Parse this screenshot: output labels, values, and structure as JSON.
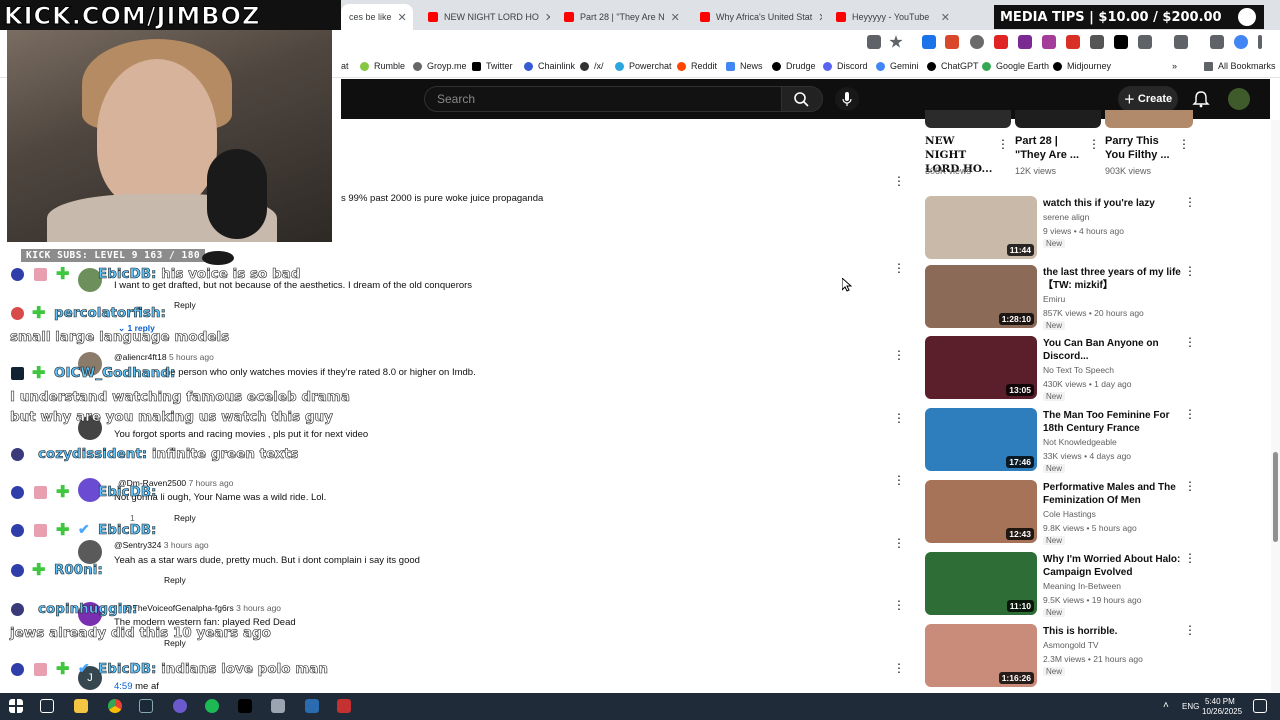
{
  "stream": {
    "brand": "KICK.COM/JIMBOZ",
    "kick_subs": "KICK SUBS: LEVEL 9 163 / 180",
    "media_tips": "MEDIA TIPS | $10.00 / $200.00"
  },
  "browser": {
    "tabs": [
      {
        "title": "ces be like",
        "color": "#ffffff",
        "active": true
      },
      {
        "title": "NEW NIGHT LORD HO",
        "color": "#ff0000"
      },
      {
        "title": "Part 28 | \"They Are N",
        "color": "#ff0000"
      },
      {
        "title": "Why Africa's United Stat",
        "color": "#ff0000"
      },
      {
        "title": "Heyyyyy - YouTube",
        "color": "#ff0000"
      }
    ],
    "bookmarks": [
      {
        "label": "at",
        "color": "#888888"
      },
      {
        "label": "Rumble",
        "color": "#85c742"
      },
      {
        "label": "Groyp.me",
        "color": "#666666"
      },
      {
        "label": "Twitter",
        "color": "#000000"
      },
      {
        "label": "Chainlink",
        "color": "#375bd2"
      },
      {
        "label": "/x/",
        "color": "#333333"
      },
      {
        "label": "Powerchat",
        "color": "#2ba6de"
      },
      {
        "label": "Reddit",
        "color": "#ff4500"
      },
      {
        "label": "News",
        "color": "#4285f4"
      },
      {
        "label": "Drudge",
        "color": "#000000"
      },
      {
        "label": "Discord",
        "color": "#5865f2"
      },
      {
        "label": "Gemini",
        "color": "#4285f4"
      },
      {
        "label": "ChatGPT",
        "color": "#000000"
      },
      {
        "label": "Google Earth",
        "color": "#34a853"
      },
      {
        "label": "Midjourney",
        "color": "#000000"
      }
    ],
    "all_bookmarks": "All Bookmarks"
  },
  "youtube": {
    "search_placeholder": "Search",
    "create_label": "Create"
  },
  "comments": [
    {
      "text": "s 99% past 2000 is pure woke juice propaganda"
    },
    {
      "text": "I want to get drafted, but not because of the aesthetics. I dream of the old conquerors",
      "reply": "Reply",
      "replies": "1 reply"
    },
    {
      "author": "@aliencr4ft18",
      "ago": "5 hours ago",
      "text": "he person who only watches movies if they're rated 8.0 or higher on Imdb."
    },
    {
      "text": "You forgot sports and racing movies , pls put it for next video"
    },
    {
      "author": "@Dm-Raven2500",
      "ago": "7 hours ago",
      "text": "Not gonna li   ough, Your Name was a wild ride. Lol.",
      "likes": "1",
      "reply": "Reply"
    },
    {
      "author": "@Sentry324",
      "ago": "3 hours ago",
      "text": "Yeah as a star wars dude, pretty much. But i dont complain i say its good",
      "reply": "Reply"
    },
    {
      "author": "@TheVoiceofGenalpha-fg6rs",
      "ago": "3 hours ago",
      "text": "The modern western fan: played Red Dead",
      "reply": "Reply"
    },
    {
      "text": "me af",
      "time": "4:59",
      "avatar": "J"
    }
  ],
  "chat": [
    {
      "name": "EbicDB:",
      "msg": "his voice is so bad"
    },
    {
      "name": "percolatorfish:",
      "msg": ""
    },
    {
      "name": "",
      "msg": "small large language models"
    },
    {
      "name": "OICW_Godhand:",
      "msg": ""
    },
    {
      "name": "",
      "msg": "I understand watching famous eceleb drama"
    },
    {
      "name": "",
      "msg": "but why are you making us watch this guy"
    },
    {
      "name": "cozydissident:",
      "msg": "infinite green texts"
    },
    {
      "name": "EbicDB:",
      "msg": ""
    },
    {
      "name": "EbicDB:",
      "msg": ""
    },
    {
      "name": "R00ni:",
      "msg": ""
    },
    {
      "name": "copinhuggin:",
      "msg": ""
    },
    {
      "name": "",
      "msg": "jews already did this 10 years ago"
    },
    {
      "name": "EbicDB:",
      "msg": "indians love polo man"
    }
  ],
  "shorts": [
    {
      "title": "NEW NIGHT LORD HO...",
      "views": "308K views"
    },
    {
      "title": "Part 28 | \"They Are ...",
      "views": "12K views"
    },
    {
      "title": "Parry This You Filthy ...",
      "views": "903K views"
    }
  ],
  "videos": [
    {
      "title": "watch this if you're lazy",
      "channel": "serene align",
      "meta": "9 views • 4 hours ago",
      "tag": "New",
      "duration": "11:44",
      "thumb": "#c9b9a8"
    },
    {
      "title": "the last three years of my life【TW: mizkif】",
      "channel": "Emiru",
      "meta": "857K views • 20 hours ago",
      "tag": "New",
      "duration": "1:28:10",
      "thumb": "#8b6a58"
    },
    {
      "title": "You Can Ban Anyone on Discord...",
      "channel": "No Text To Speech",
      "meta": "430K views • 1 day ago",
      "tag": "New",
      "duration": "13:05",
      "thumb": "#5a1f2a"
    },
    {
      "title": "The Man Too Feminine For 18th Century France",
      "channel": "Not Knowledgeable",
      "meta": "33K views • 4 days ago",
      "tag": "New",
      "duration": "17:46",
      "thumb": "#2e7dbc"
    },
    {
      "title": "Performative Males and The Feminization Of Men",
      "channel": "Cole Hastings",
      "meta": "9.8K views • 5 hours ago",
      "tag": "New",
      "duration": "12:43",
      "thumb": "#a67358"
    },
    {
      "title": "Why I'm Worried About Halo: Campaign Evolved",
      "channel": "Meaning In-Between",
      "meta": "9.5K views • 19 hours ago",
      "tag": "New",
      "duration": "11:10",
      "thumb": "#2f6d36"
    },
    {
      "title": "This is horrible.",
      "channel": "Asmongold TV",
      "meta": "2.3M views • 21 hours ago",
      "tag": "New",
      "duration": "1:16:26",
      "thumb": "#c98b7a"
    }
  ],
  "taskbar": {
    "lang": "ENG",
    "time": "5:40 PM",
    "date": "10/26/2025"
  }
}
